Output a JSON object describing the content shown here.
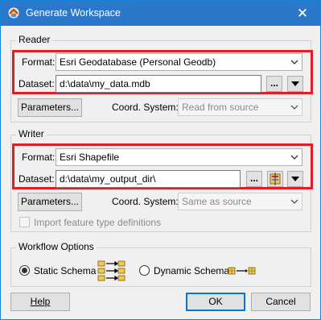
{
  "window": {
    "title": "Generate Workspace",
    "close_glyph": "✕"
  },
  "reader": {
    "group_title": "Reader",
    "format_label": "Format:",
    "format_value": "Esri Geodatabase (Personal Geodb)",
    "dataset_label": "Dataset:",
    "dataset_value": "d:\\data\\my_data.mdb",
    "browse_label": "...",
    "parameters_label": "Parameters...",
    "coord_label": "Coord. System:",
    "coord_value": "Read from source"
  },
  "writer": {
    "group_title": "Writer",
    "format_label": "Format:",
    "format_value": "Esri Shapefile",
    "dataset_label": "Dataset:",
    "dataset_value": "d:\\data\\my_output_dir\\",
    "browse_label": "...",
    "parameters_label": "Parameters...",
    "coord_label": "Coord. System:",
    "coord_value": "Same as source",
    "import_label": "Import feature type definitions"
  },
  "workflow": {
    "group_title": "Workflow Options",
    "static_label": "Static Schema",
    "dynamic_label": "Dynamic Schema",
    "selected": "Static Schema"
  },
  "footer": {
    "help_label": "Help",
    "ok_label": "OK",
    "cancel_label": "Cancel"
  },
  "colors": {
    "titlebar": "#2b77c9",
    "highlight": "#e51c23",
    "default_button_border": "#0078d7"
  },
  "icons": [
    "fme-app-icon",
    "close-icon",
    "chevron-down-icon",
    "dropdown-arrow-icon",
    "folder-navigator-icon",
    "static-schema-icon",
    "dynamic-schema-icon"
  ]
}
